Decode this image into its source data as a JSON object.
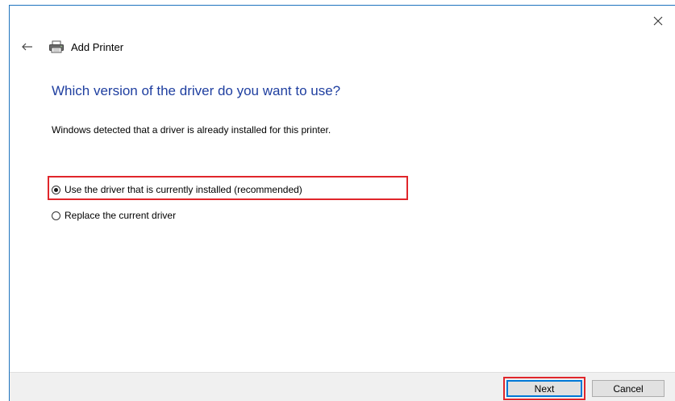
{
  "window": {
    "title": "Add Printer",
    "close_glyph": "✕",
    "back_glyph": "←"
  },
  "content": {
    "heading": "Which version of the driver do you want to use?",
    "description": "Windows detected that a driver is already installed for this printer."
  },
  "options": [
    {
      "label": "Use the driver that is currently installed (recommended)",
      "selected": true
    },
    {
      "label": "Replace the current driver",
      "selected": false
    }
  ],
  "buttons": {
    "next": "Next",
    "cancel": "Cancel"
  },
  "colors": {
    "accent": "#1e73be",
    "heading": "#1f3fa0",
    "highlight": "#e0262b"
  },
  "icons": {
    "close": "close-icon",
    "back": "back-arrow-icon",
    "printer": "printer-icon"
  }
}
